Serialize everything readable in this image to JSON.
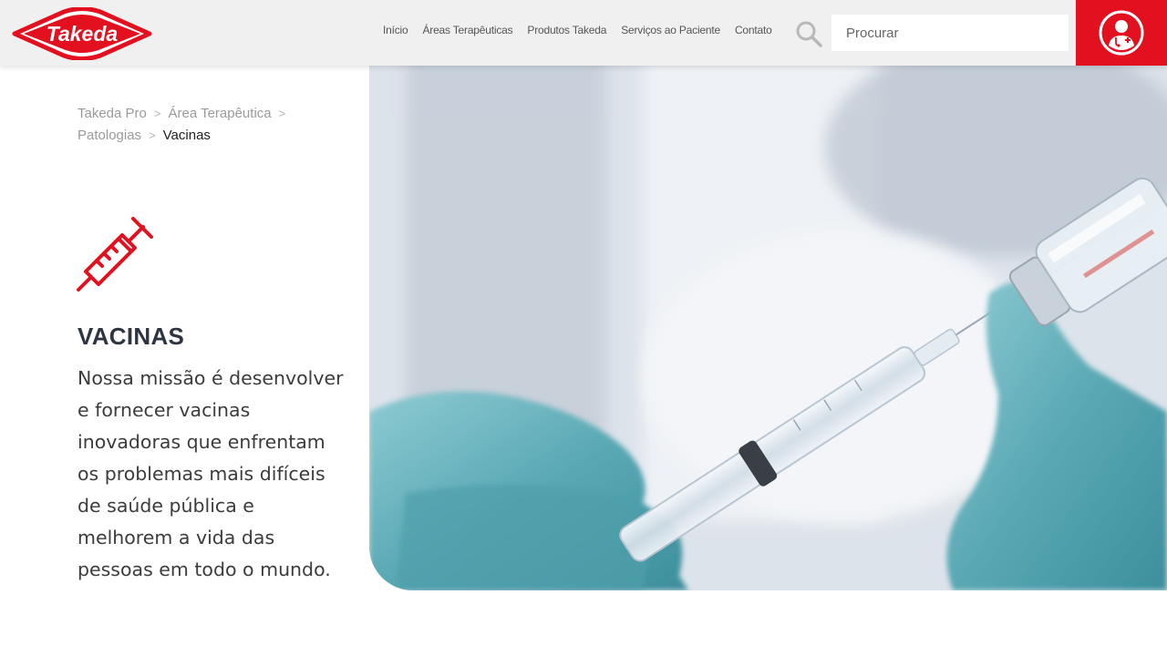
{
  "header": {
    "logo_text": "Takeda",
    "nav": [
      {
        "label": "Início"
      },
      {
        "label": "Áreas Terapêuticas"
      },
      {
        "label": "Produtos Takeda"
      },
      {
        "label": "Serviços ao Paciente"
      },
      {
        "label": "Contato"
      }
    ],
    "search": {
      "placeholder": "Procurar",
      "value": ""
    },
    "icons": {
      "search": "search-icon",
      "user": "doctor-user-icon"
    },
    "colors": {
      "brand_red": "#e3111f",
      "header_bg": "#f0f0f0"
    }
  },
  "breadcrumb": {
    "items": [
      "Takeda Pro",
      "Área Terapêutica",
      "Patologias"
    ],
    "current": "Vacinas",
    "separator": ">"
  },
  "main": {
    "icon": "syringe-icon",
    "title": "VACINAS",
    "description": "Nossa missão é desenvolver e fornecer vacinas inovadoras que enfrentam os problemas mais difíceis de saúde pública e melhorem a vida das pessoas em todo o mundo."
  },
  "hero": {
    "image": "vaccine-syringe-photo"
  }
}
